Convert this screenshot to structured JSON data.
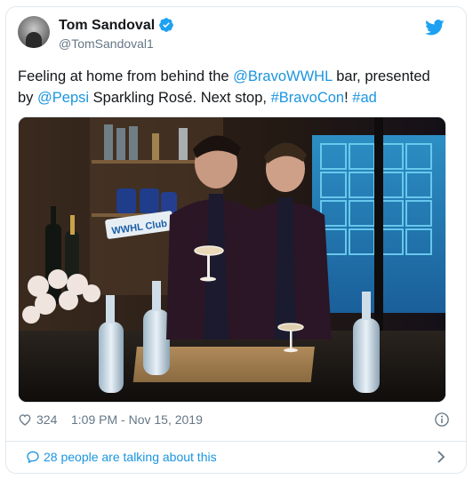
{
  "author": {
    "display_name": "Tom Sandoval",
    "handle": "@TomSandoval1",
    "verified": true
  },
  "tweet": {
    "text_1": "Feeling at home from behind the ",
    "mention_1": "@BravoWWHL",
    "text_2": " bar, presented by ",
    "mention_2": "@Pepsi",
    "text_3": " Sparkling Rosé. Next stop, ",
    "hashtag_1": "#BravoCon",
    "text_4": "! ",
    "hashtag_2": "#ad"
  },
  "media": {
    "sign_text": "WWHL Club"
  },
  "meta": {
    "likes": "324",
    "timestamp": "1:09 PM - Nov 15, 2019"
  },
  "footer": {
    "talking": "28 people are talking about this"
  },
  "colors": {
    "link": "#1b95e0",
    "secondary_text": "#657786",
    "border": "#e1e8ed",
    "twitter_blue": "#1da1f2"
  },
  "icons": [
    "verified-icon",
    "twitter-bird-icon",
    "heart-icon",
    "info-icon",
    "comment-icon",
    "chevron-right-icon"
  ]
}
